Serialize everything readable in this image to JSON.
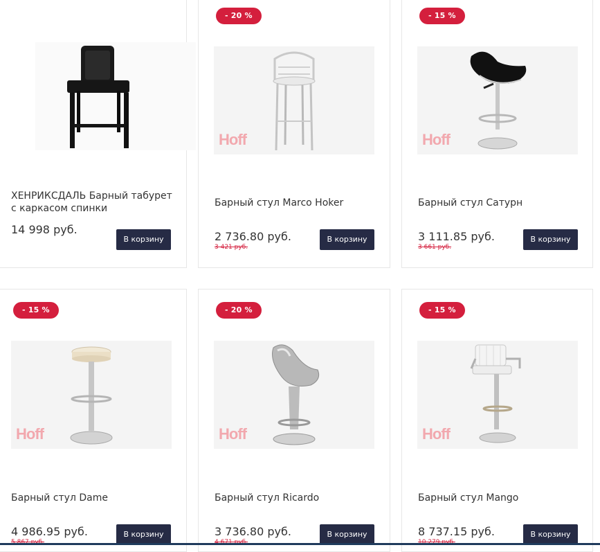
{
  "colors": {
    "badge": "#d41f3d",
    "button": "#262b45",
    "old_price": "#d41f3d"
  },
  "products": [
    {
      "title": "ХЕНРИКСДАЛЬ Барный табурет с каркасом спинки",
      "price": "14 998 руб.",
      "old_price": "",
      "discount": "",
      "button": "В корзину",
      "brand_watermark": "",
      "icon": "black-bar-stool-with-back-image"
    },
    {
      "title": "Барный стул Marco Hoker",
      "price": "2 736.80 руб.",
      "old_price": "3 421 руб.",
      "discount": "- 20 %",
      "button": "В корзину",
      "brand_watermark": "Hoff",
      "icon": "white-metal-bar-stool-image"
    },
    {
      "title": "Барный стул Сатурн",
      "price": "3 111.85 руб.",
      "old_price": "3 661 руб.",
      "discount": "- 15 %",
      "button": "В корзину",
      "brand_watermark": "Hoff",
      "icon": "black-saturn-bar-stool-image"
    },
    {
      "title": "Барный стул Dame",
      "price": "4 986.95 руб.",
      "old_price": "5 867 руб.",
      "discount": "- 15 %",
      "button": "В корзину",
      "brand_watermark": "Hoff",
      "icon": "white-round-bar-stool-image"
    },
    {
      "title": "Барный стул Ricardo",
      "price": "3 736.80 руб.",
      "old_price": "4 671 руб.",
      "discount": "- 20 %",
      "button": "В корзину",
      "brand_watermark": "Hoff",
      "icon": "silver-ricardo-bar-stool-image"
    },
    {
      "title": "Барный стул Mango",
      "price": "8 737.15 руб.",
      "old_price": "10 279 руб.",
      "discount": "- 15 %",
      "button": "В корзину",
      "brand_watermark": "Hoff",
      "icon": "white-mango-bar-stool-image"
    }
  ]
}
